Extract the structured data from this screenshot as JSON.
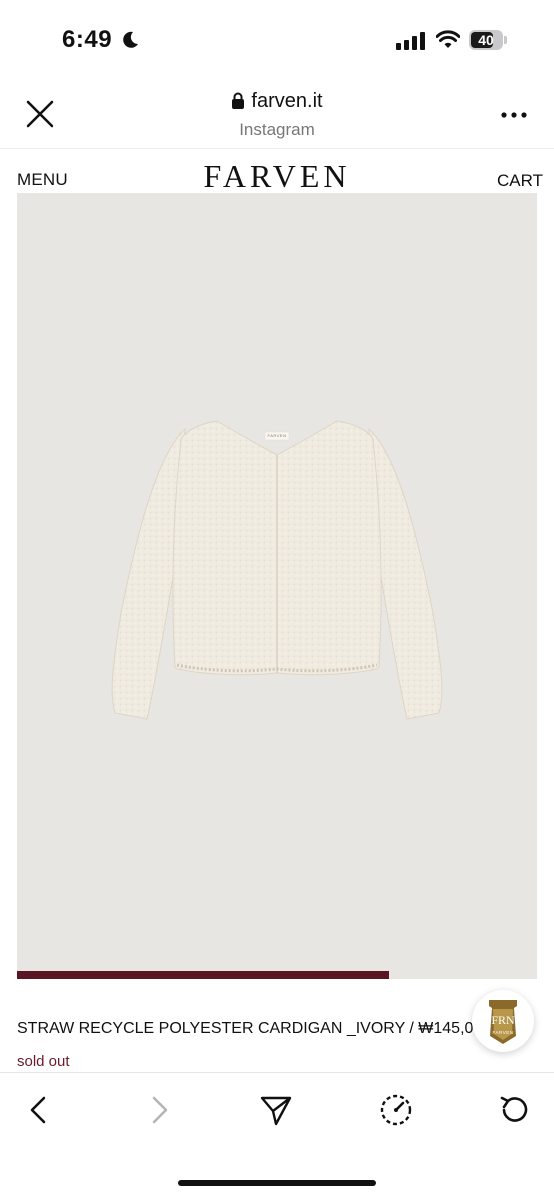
{
  "status_bar": {
    "time": "6:49",
    "battery": "40"
  },
  "browser": {
    "url": "farven.it",
    "source": "Instagram"
  },
  "site": {
    "menu_label": "MENU",
    "logo": "FARVEN",
    "cart_label": "CART"
  },
  "product": {
    "title": "STRAW RECYCLE POLYESTER CARDIGAN _IVORY / ₩145,000",
    "status": "sold out",
    "image_label": "FARVEN",
    "gallery_progress": 0.715
  },
  "badge": {
    "text_top": "FRN",
    "text_bottom": "FARVEN"
  },
  "colors": {
    "accent": "#5a1424",
    "status": "#6b1a2a",
    "image_bg": "#e8e6e3",
    "badge_gold": "#8a6a2a"
  },
  "icons": [
    "moon-icon",
    "signal-icon",
    "wifi-icon",
    "battery-icon",
    "close-icon",
    "lock-icon",
    "more-icon",
    "chevron-left-icon",
    "chevron-right-icon",
    "share-icon",
    "compass-icon",
    "reload-icon"
  ]
}
